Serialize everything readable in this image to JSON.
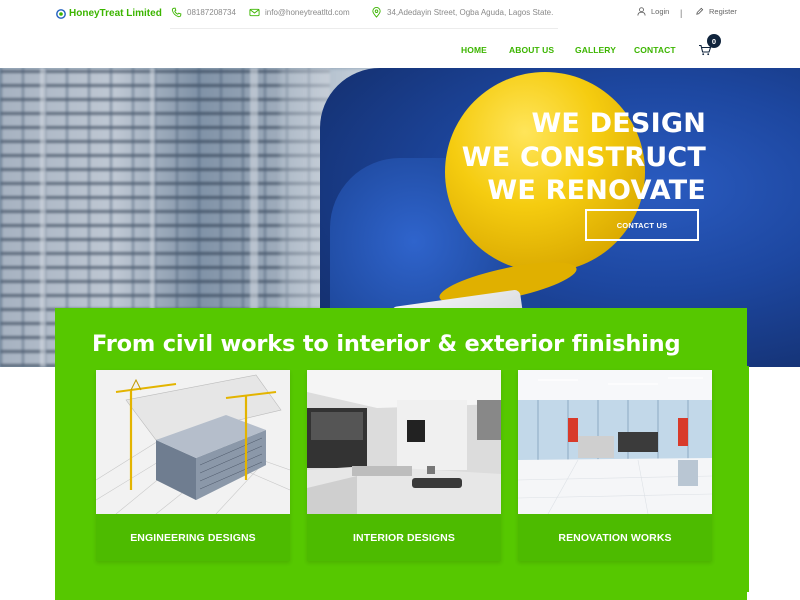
{
  "brand": {
    "name": "HoneyTreat Limited",
    "accent": "#3cb500",
    "green_panel": "#56c800"
  },
  "header": {
    "phone": "08187208734",
    "email": "info@honeytreatltd.com",
    "address": "34,Adedayin Street, Ogba Aguda, Lagos State.",
    "login_label": "Login",
    "register_label": "Register",
    "separator": "|"
  },
  "nav": {
    "items": [
      {
        "label": "HOME"
      },
      {
        "label": "ABOUT US"
      },
      {
        "label": "GALLERY"
      },
      {
        "label": "CONTACT"
      }
    ],
    "cart_count": "0"
  },
  "hero": {
    "lines": [
      "WE DESIGN",
      "WE CONSTRUCT",
      "WE RENOVATE"
    ],
    "cta_label": "CONTACT US"
  },
  "services": {
    "title": "From civil works to interior & exterior finishing",
    "cards": [
      {
        "label": "ENGINEERING DESIGNS"
      },
      {
        "label": "INTERIOR DESIGNS"
      },
      {
        "label": "RENOVATION WORKS"
      }
    ]
  },
  "icons": [
    "logo-icon",
    "phone-icon",
    "email-icon",
    "location-icon",
    "user-icon",
    "pen-icon",
    "cart-icon"
  ]
}
